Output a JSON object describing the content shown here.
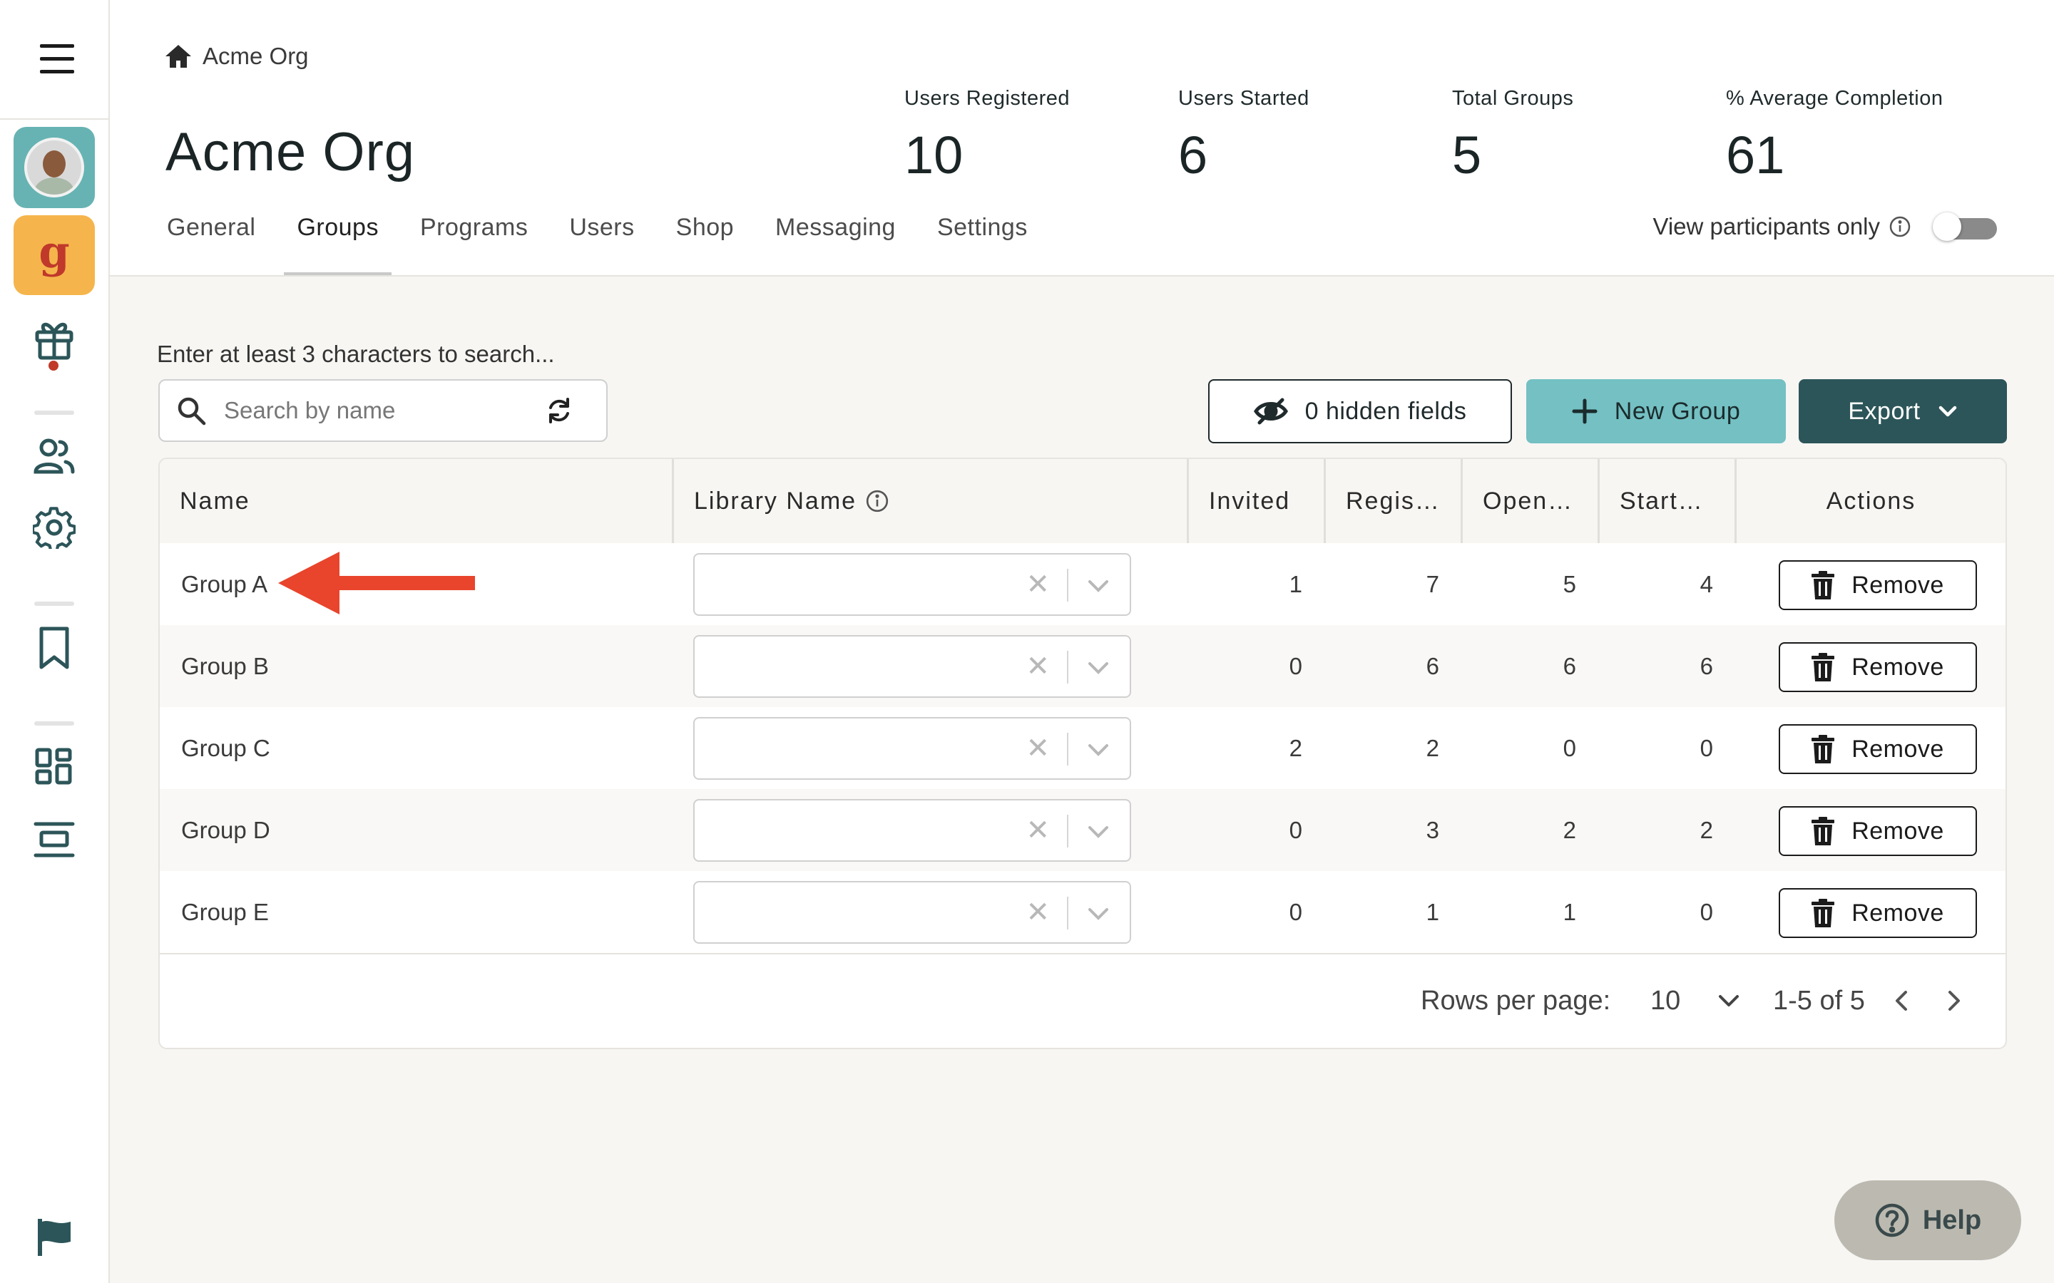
{
  "breadcrumb": {
    "label": "Acme Org"
  },
  "page": {
    "title": "Acme Org"
  },
  "stats": [
    {
      "label": "Users Registered",
      "value": "10"
    },
    {
      "label": "Users Started",
      "value": "6"
    },
    {
      "label": "Total Groups",
      "value": "5"
    },
    {
      "label": "% Average Completion",
      "value": "61"
    }
  ],
  "tabs": [
    "General",
    "Groups",
    "Programs",
    "Users",
    "Shop",
    "Messaging",
    "Settings"
  ],
  "active_tab": "Groups",
  "view_participants": {
    "label": "View participants only",
    "enabled": false
  },
  "search": {
    "hint": "Enter at least 3 characters to search...",
    "placeholder": "Search by name",
    "value": ""
  },
  "toolbar": {
    "hidden_fields_label": "0 hidden fields",
    "new_group_label": "New Group",
    "export_label": "Export"
  },
  "table": {
    "columns": [
      "Name",
      "Library Name",
      "Invited",
      "Regis…",
      "Open…",
      "Start…",
      "Actions"
    ],
    "rows": [
      {
        "name": "Group A",
        "library": "",
        "invited": "1",
        "registered": "7",
        "opened": "5",
        "started": "4",
        "action": "Remove"
      },
      {
        "name": "Group B",
        "library": "",
        "invited": "0",
        "registered": "6",
        "opened": "6",
        "started": "6",
        "action": "Remove"
      },
      {
        "name": "Group C",
        "library": "",
        "invited": "2",
        "registered": "2",
        "opened": "0",
        "started": "0",
        "action": "Remove"
      },
      {
        "name": "Group D",
        "library": "",
        "invited": "0",
        "registered": "3",
        "opened": "2",
        "started": "2",
        "action": "Remove"
      },
      {
        "name": "Group E",
        "library": "",
        "invited": "0",
        "registered": "1",
        "opened": "1",
        "started": "0",
        "action": "Remove"
      }
    ]
  },
  "pagination": {
    "rows_per_page_label": "Rows per page:",
    "rows_per_page": "10",
    "range": "1-5 of 5"
  },
  "help": {
    "label": "Help"
  },
  "brand": {
    "letter": "g"
  },
  "colors": {
    "accent": "#74c0c3",
    "dark": "#2c5559",
    "annotation": "#e8452c",
    "brand": "#f5b54c"
  }
}
